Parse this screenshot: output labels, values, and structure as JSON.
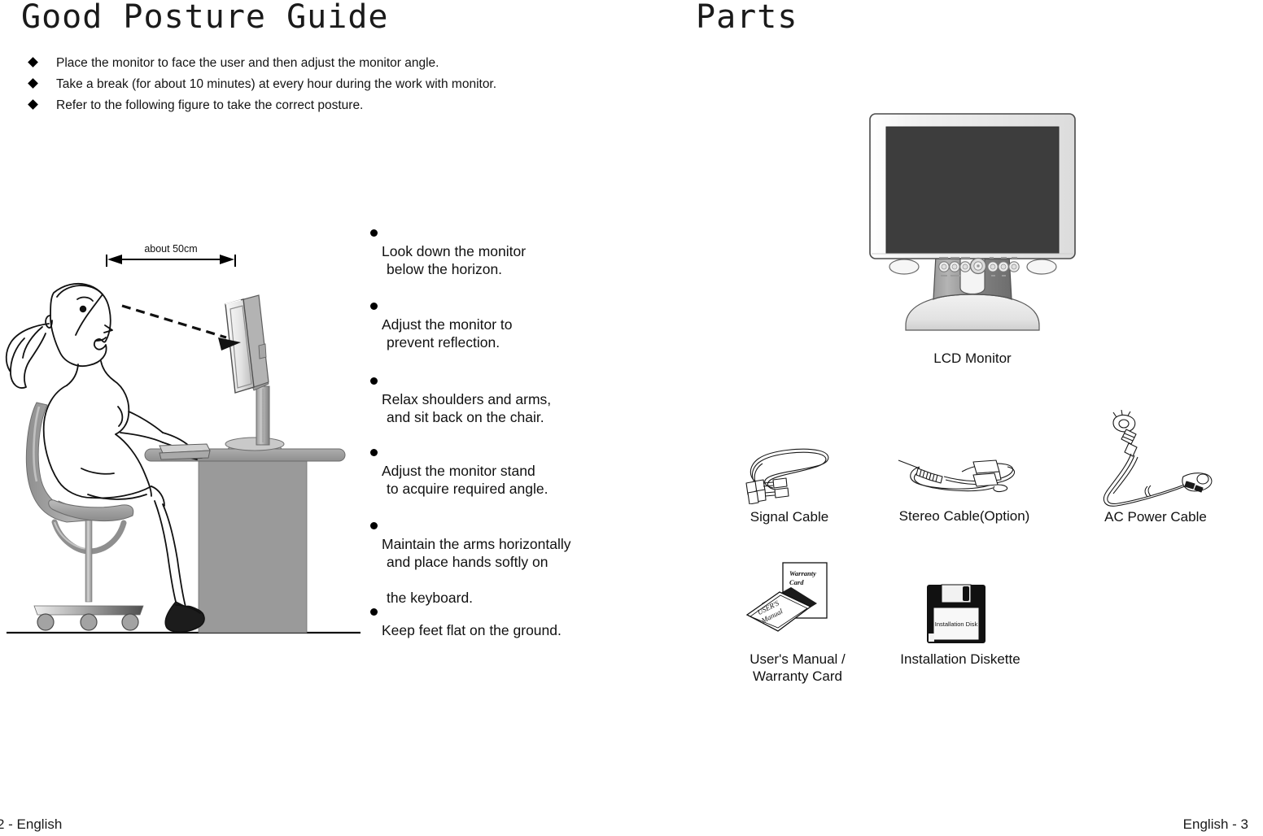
{
  "document": {
    "left_page": {
      "title": "Good Posture Guide",
      "footer": "2 - English",
      "intro_items": [
        "Place the monitor to face the user and then adjust the monitor angle.",
        "Take a break (for about 10 minutes) at every hour during the work with monitor.",
        "Refer to the following figure to take the correct posture."
      ],
      "ruler_label": "about 50cm",
      "tips": [
        {
          "line1": "Look down the monitor",
          "line2": "below the horizon."
        },
        {
          "line1": "Adjust the monitor to",
          "line2": "prevent reflection."
        },
        {
          "line1": "Relax shoulders and arms,",
          "line2": "and sit back on the chair."
        },
        {
          "line1": "Adjust the monitor stand",
          "line2": "to acquire required angle."
        },
        {
          "line1": "Maintain the arms horizontally",
          "line2": "and place hands softly on",
          "line3": "the keyboard."
        },
        {
          "line1": "Keep feet flat on the ground.",
          "line2": ""
        }
      ]
    },
    "right_page": {
      "title": "Parts",
      "footer": "English - 3",
      "items": [
        {
          "name": "lcd-monitor",
          "caption": "LCD Monitor"
        },
        {
          "name": "signal-cable",
          "caption": "Signal Cable"
        },
        {
          "name": "stereo-cable",
          "caption": "Stereo Cable(Option)"
        },
        {
          "name": "ac-power-cable",
          "caption": "AC Power Cable"
        },
        {
          "name": "manual-warranty",
          "caption": "User's Manual /\nWarranty Card"
        },
        {
          "name": "installation-diskette",
          "caption": "Installation Diskette"
        }
      ],
      "artwork_labels": {
        "warranty_card": "Warranty\nCard",
        "users_manual_l1": "USER'S",
        "users_manual_l2": "Manual",
        "diskette_label": "Installation Disk"
      }
    }
  },
  "colors": {
    "ink": "#000000",
    "text": "#111111",
    "screen_dark": "#3d3d3d",
    "bezel_light": "#ededed",
    "stand_gray": "#7d7d7d",
    "furniture_gray": "#9a9a9a",
    "chair_gray": "#a0a0a0"
  }
}
